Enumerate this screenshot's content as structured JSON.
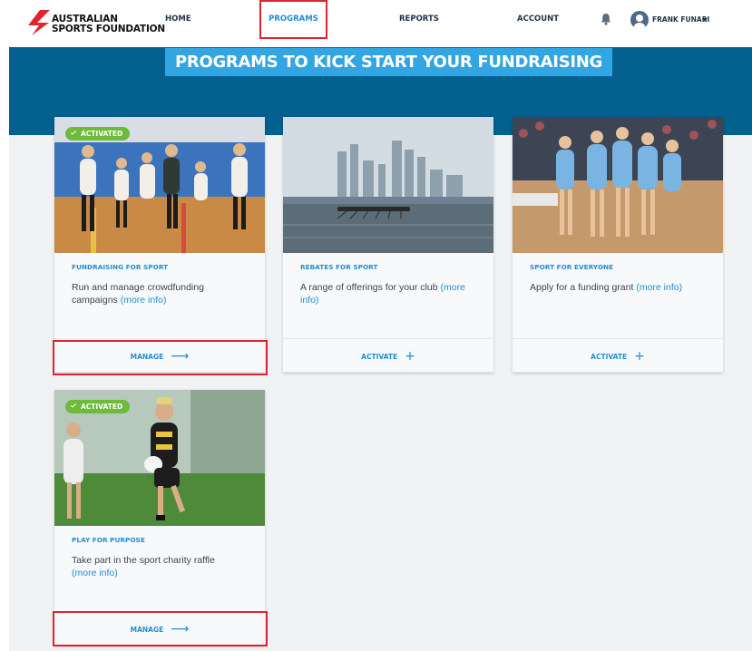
{
  "brand": {
    "line1": "AUSTRALIAN",
    "line2": "SPORTS FOUNDATION",
    "accent": "#e0232e"
  },
  "nav": {
    "home": "HOME",
    "programs": "PROGRAMS",
    "reports": "REPORTS",
    "account": "ACCOUNT",
    "active": "PROGRAMS"
  },
  "user": {
    "name": "FRANK FUNARI",
    "icons": [
      "bell-icon",
      "avatar-icon",
      "caret-down-icon"
    ]
  },
  "hero": {
    "title": "PROGRAMS TO KICK START YOUR FUNDRAISING"
  },
  "colors": {
    "hero_bg": "#03608f",
    "title_bg": "#31a6e2",
    "link": "#1f8fd2",
    "badge": "#6cbb3a"
  },
  "programs": [
    {
      "badge": "ACTIVATED",
      "label": "FUNDRAISING FOR SPORT",
      "desc_line1": "Run and manage crowdfunding",
      "desc_line2": "campaigns",
      "more": "(more info)",
      "action": "MANAGE",
      "action_icon": "arrow-right-icon"
    },
    {
      "badge": "",
      "label": "REBATES FOR SPORT",
      "desc_line1": "A range of offerings for your club",
      "desc_line2": "",
      "more": "(more info)",
      "action": "ACTIVATE",
      "action_icon": "plus-icon"
    },
    {
      "badge": "",
      "label": "SPORT FOR EVERYONE",
      "desc_line1": "Apply for a funding grant",
      "desc_line2": "",
      "more": "(more info)",
      "action": "ACTIVATE",
      "action_icon": "plus-icon"
    },
    {
      "badge": "ACTIVATED",
      "label": "PLAY FOR PURPOSE",
      "desc_line1": "Take part in the sport charity raffle",
      "desc_line2": "",
      "more": "(more info)",
      "action": "MANAGE",
      "action_icon": "arrow-right-icon"
    }
  ]
}
